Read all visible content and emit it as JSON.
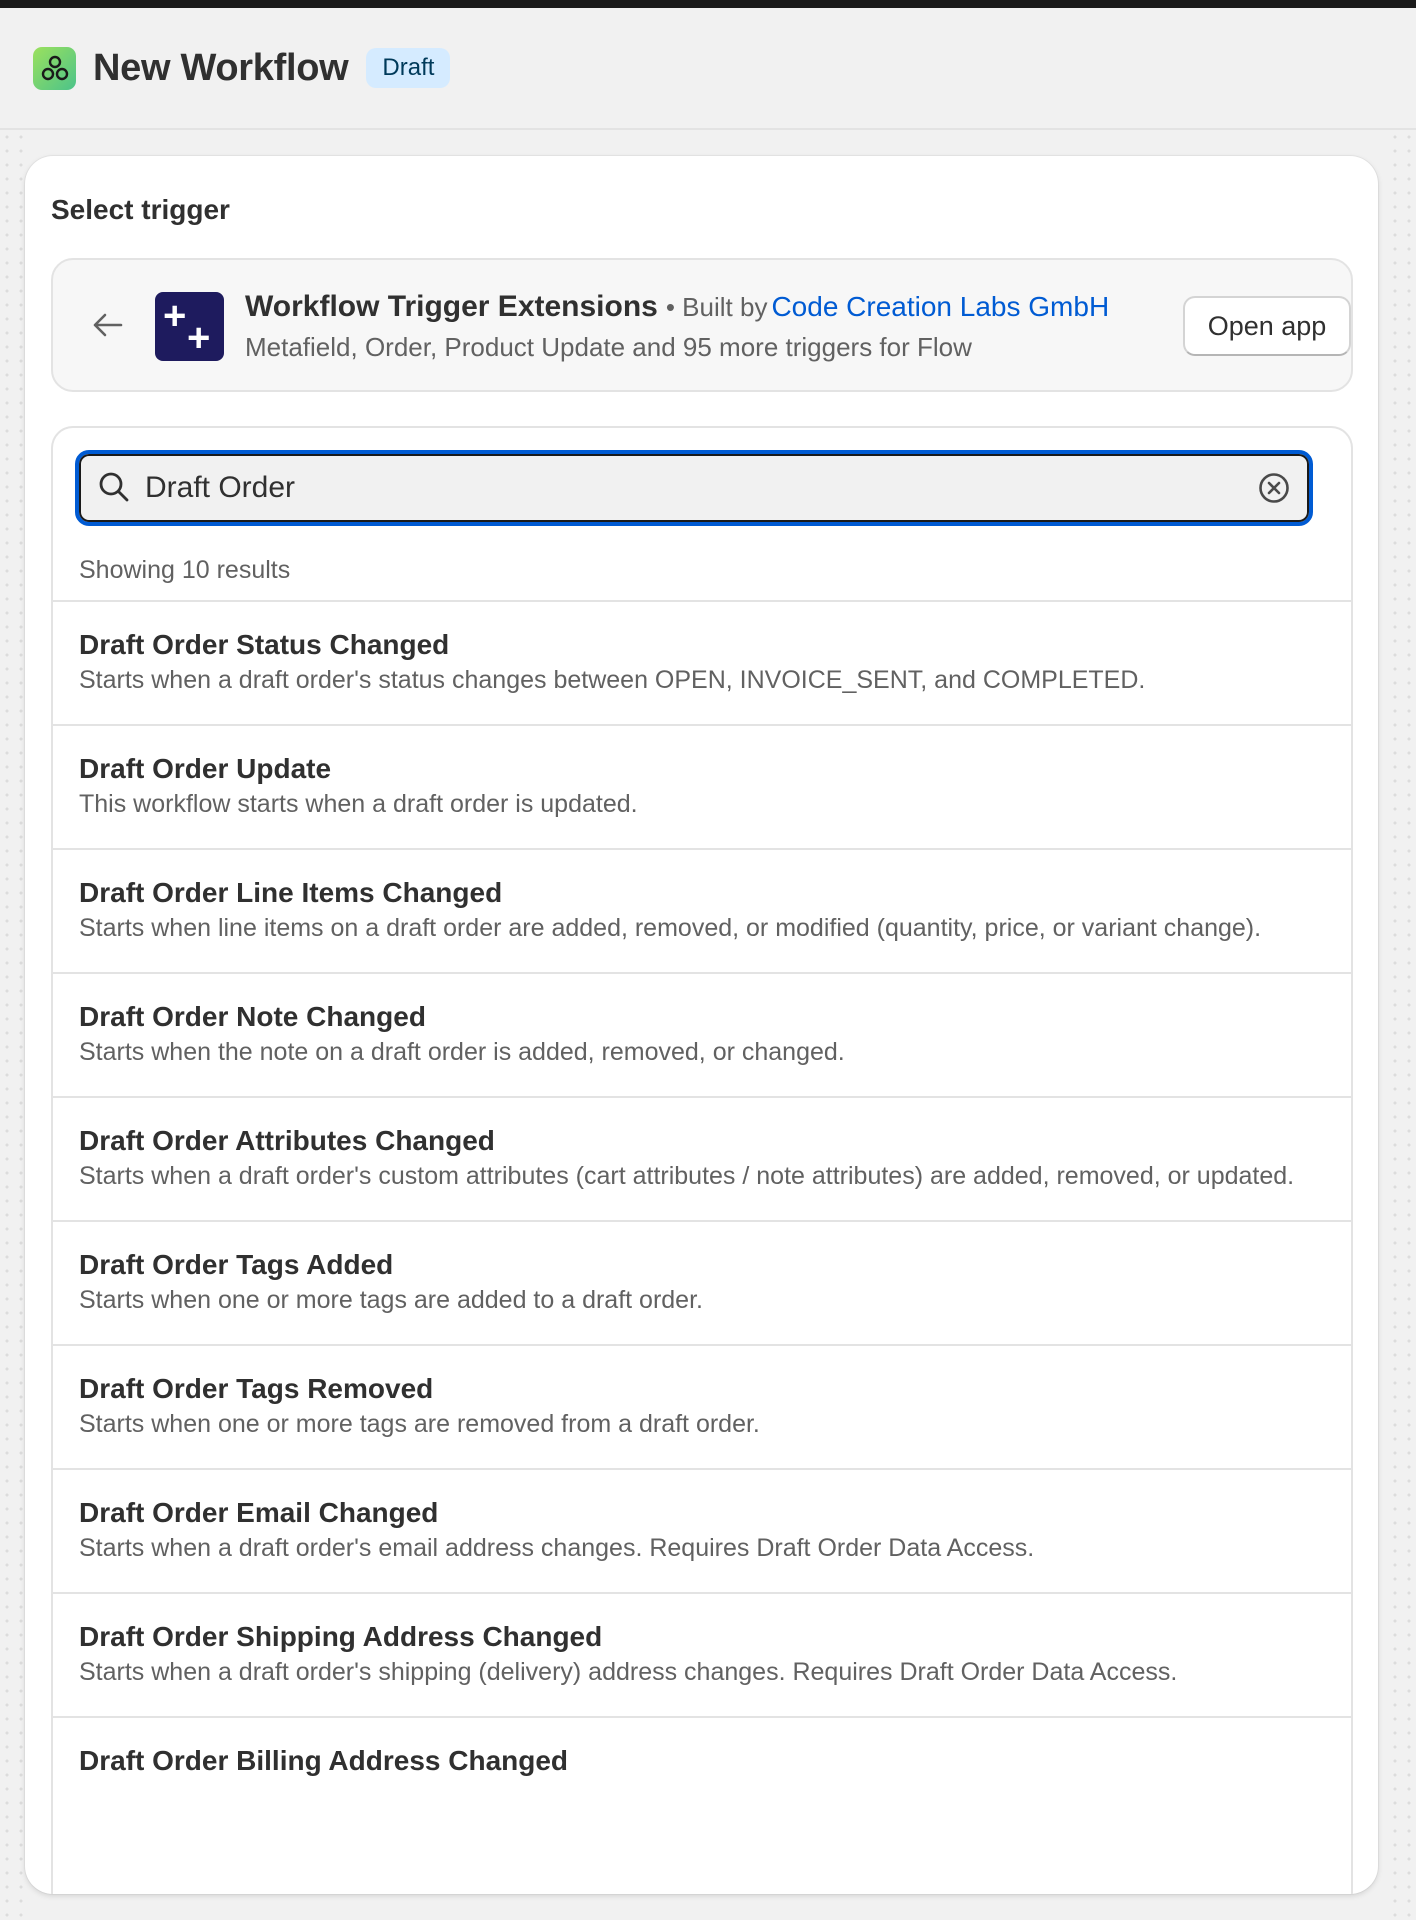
{
  "header": {
    "title": "New Workflow",
    "badge": "Draft"
  },
  "panel": {
    "title": "Select trigger"
  },
  "app": {
    "name": "Workflow Trigger Extensions",
    "built_by": "• Built by",
    "developer": "Code Creation Labs GmbH",
    "description": "Metafield, Order, Product Update and 95 more triggers for Flow",
    "open_label": "Open app"
  },
  "search": {
    "value": "Draft Order",
    "results_text": "Showing 10 results"
  },
  "results": [
    {
      "title": "Draft Order Status Changed",
      "description": "Starts when a draft order's status changes between OPEN, INVOICE_SENT, and COMPLETED."
    },
    {
      "title": "Draft Order Update",
      "description": "This workflow starts when a draft order is updated."
    },
    {
      "title": "Draft Order Line Items Changed",
      "description": "Starts when line items on a draft order are added, removed, or modified (quantity, price, or variant change)."
    },
    {
      "title": "Draft Order Note Changed",
      "description": "Starts when the note on a draft order is added, removed, or changed."
    },
    {
      "title": "Draft Order Attributes Changed",
      "description": "Starts when a draft order's custom attributes (cart attributes / note attributes) are added, removed, or updated."
    },
    {
      "title": "Draft Order Tags Added",
      "description": "Starts when one or more tags are added to a draft order."
    },
    {
      "title": "Draft Order Tags Removed",
      "description": "Starts when one or more tags are removed from a draft order."
    },
    {
      "title": "Draft Order Email Changed",
      "description": "Starts when a draft order's email address changes. Requires Draft Order Data Access."
    },
    {
      "title": "Draft Order Shipping Address Changed",
      "description": "Starts when a draft order's shipping (delivery) address changes. Requires Draft Order Data Access."
    },
    {
      "title": "Draft Order Billing Address Changed",
      "description": ""
    }
  ]
}
